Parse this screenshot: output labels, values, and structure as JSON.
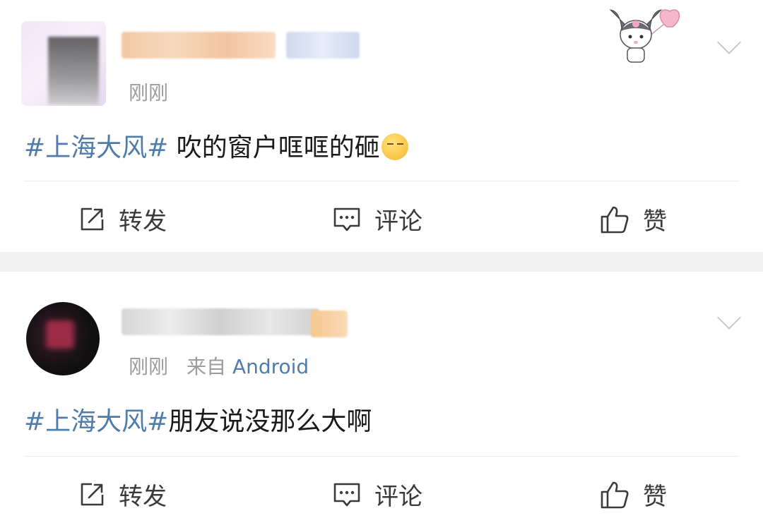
{
  "posts": [
    {
      "time": "刚刚",
      "source_prefix": "",
      "source_app": "",
      "hashtag": "#上海大风#",
      "text": " 吹的窗户哐哐的砸",
      "emoji": "smirk-emoji",
      "actions": {
        "repost": "转发",
        "comment": "评论",
        "like": "赞"
      }
    },
    {
      "time": "刚刚",
      "source_prefix": "来自",
      "source_app": "Android",
      "hashtag": "#上海大风#",
      "text": "朋友说没那么大啊",
      "actions": {
        "repost": "转发",
        "comment": "评论",
        "like": "赞"
      }
    }
  ],
  "colors": {
    "link": "#4f7cab",
    "meta": "#9b9b9b",
    "separator": "#f1f1f1"
  },
  "icons": [
    "repost-icon",
    "comment-icon",
    "like-icon",
    "chevron-down-icon",
    "kuromi-sticker"
  ]
}
